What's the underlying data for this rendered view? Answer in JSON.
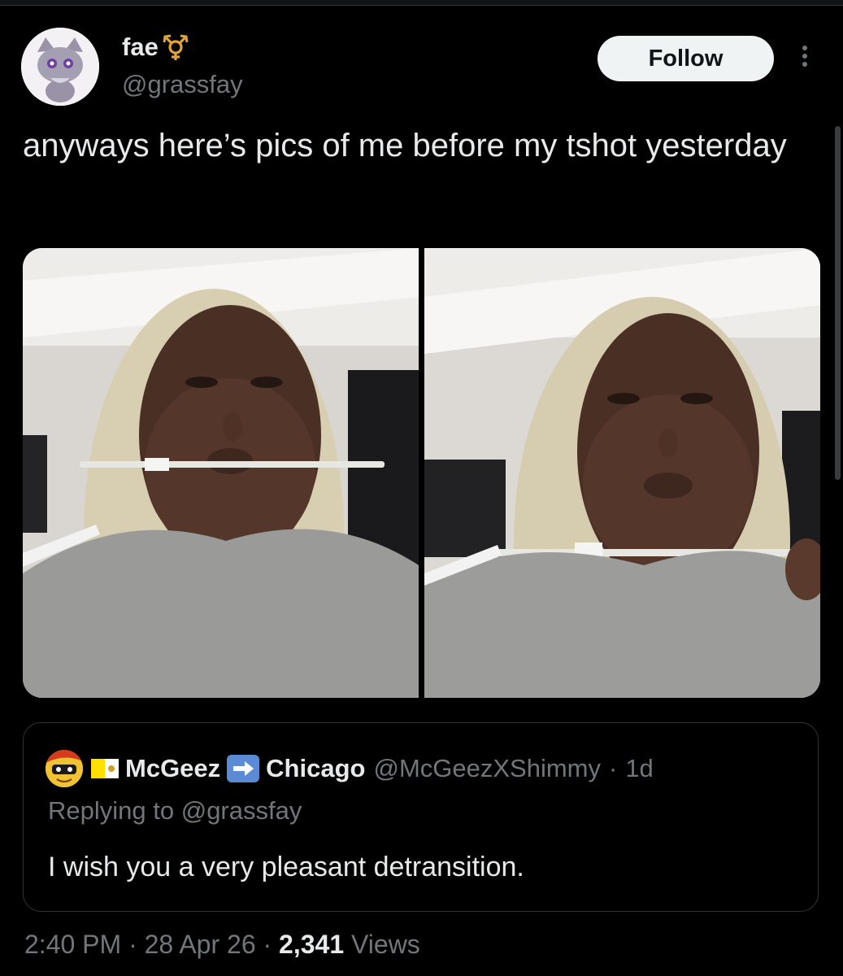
{
  "author": {
    "display_name": "fae",
    "badge_icon": "transgender-symbol-icon",
    "handle": "@grassfay",
    "avatar_icon": "espurr-avatar"
  },
  "actions": {
    "follow_label": "Follow",
    "more_icon": "vertical-ellipsis-icon"
  },
  "tweet": {
    "text": "anyways here’s pics of me before my tshot yesterday"
  },
  "media": [
    {
      "name": "photo-left"
    },
    {
      "name": "photo-right"
    }
  ],
  "quoted_tweet": {
    "flag_icon": "vatican-flag-icon",
    "name_part1": "McGeez",
    "arrow_icon": "right-arrow-emoji-icon",
    "name_part2": "Chicago",
    "handle": "@McGeezXShimmy",
    "separator": "·",
    "time": "1d",
    "replying_prefix": "Replying to",
    "replying_to": "@grassfay",
    "text": "I wish you a very pleasant detransition."
  },
  "meta": {
    "time": "2:40 PM",
    "sep1": "·",
    "date": "28 Apr 26",
    "sep2": "·",
    "views_count": "2,341",
    "views_label": "Views"
  },
  "colors": {
    "background": "#000000",
    "text_primary": "#e7e9ea",
    "text_secondary": "#71767b",
    "link": "#1d9bf0",
    "follow_bg": "#eff3f4"
  }
}
